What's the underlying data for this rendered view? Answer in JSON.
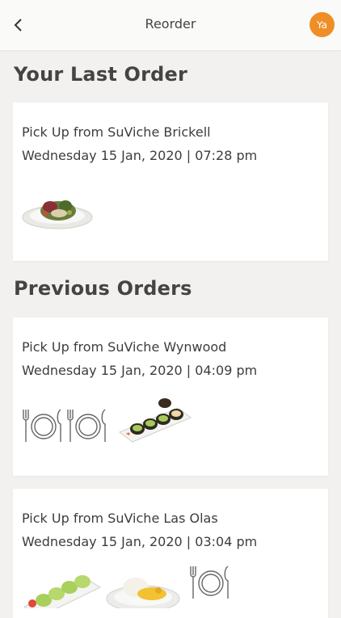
{
  "header": {
    "title": "Reorder",
    "back_icon": "chevron-left-icon",
    "avatar_initials": "Ya",
    "avatar_color": "#ef8e27"
  },
  "last_order": {
    "section_title": "Your Last Order",
    "order": {
      "pickup": "Pick Up from SuViche Brickell",
      "datetime": "Wednesday 15 Jan, 2020 | 07:28 pm",
      "items": [
        "salad-bowl-image"
      ]
    }
  },
  "previous_orders": {
    "section_title": "Previous Orders",
    "orders": [
      {
        "pickup": "Pick Up from SuViche Wynwood",
        "datetime": "Wednesday 15 Jan, 2020 | 04:09 pm",
        "items": [
          "cutlery-plate-icon",
          "cutlery-plate-icon",
          "sushi-rolls-image"
        ]
      },
      {
        "pickup": "Pick Up from SuViche Las Olas",
        "datetime": "Wednesday 15 Jan, 2020 | 03:04 pm",
        "items": [
          "sushi-platter-image",
          "rice-bowl-image",
          "cutlery-plate-icon"
        ]
      }
    ]
  }
}
